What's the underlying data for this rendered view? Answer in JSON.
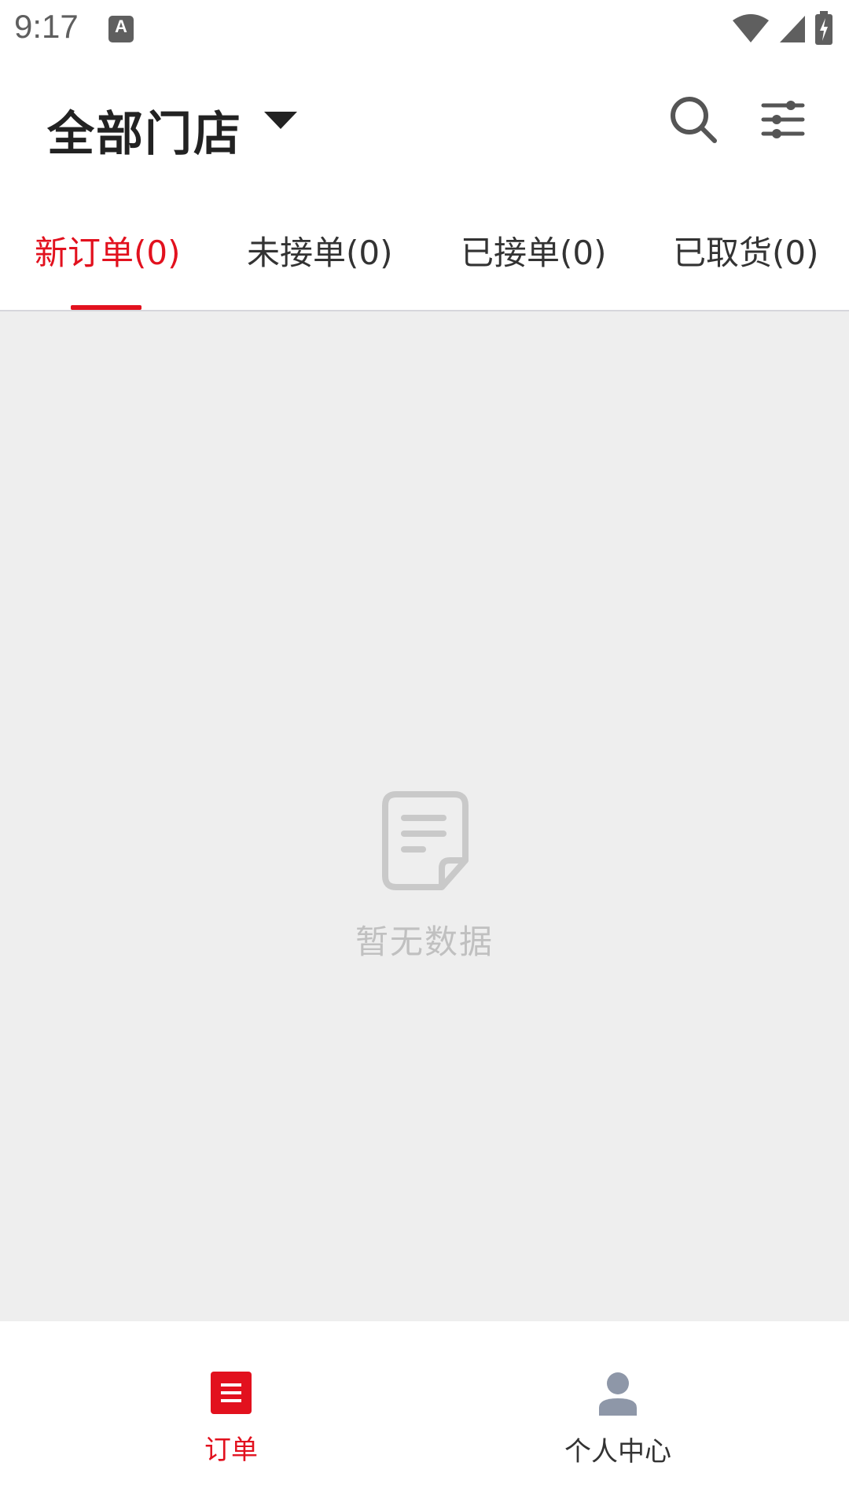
{
  "status_bar": {
    "time": "9:17",
    "notification_badge": "A"
  },
  "header": {
    "store_title": "全部门店"
  },
  "tabs": [
    {
      "label": "新订单(0)",
      "active": true
    },
    {
      "label": "未接单(0)",
      "active": false
    },
    {
      "label": "已接单(0)",
      "active": false
    },
    {
      "label": "已取货(0)",
      "active": false
    }
  ],
  "empty_state": {
    "text": "暂无数据"
  },
  "bottom_nav": [
    {
      "label": "订单",
      "active": true
    },
    {
      "label": "个人中心",
      "active": false
    }
  ],
  "colors": {
    "accent": "#e2111e",
    "content_bg": "#eeeeee",
    "inactive_icon": "#8e97a8"
  }
}
